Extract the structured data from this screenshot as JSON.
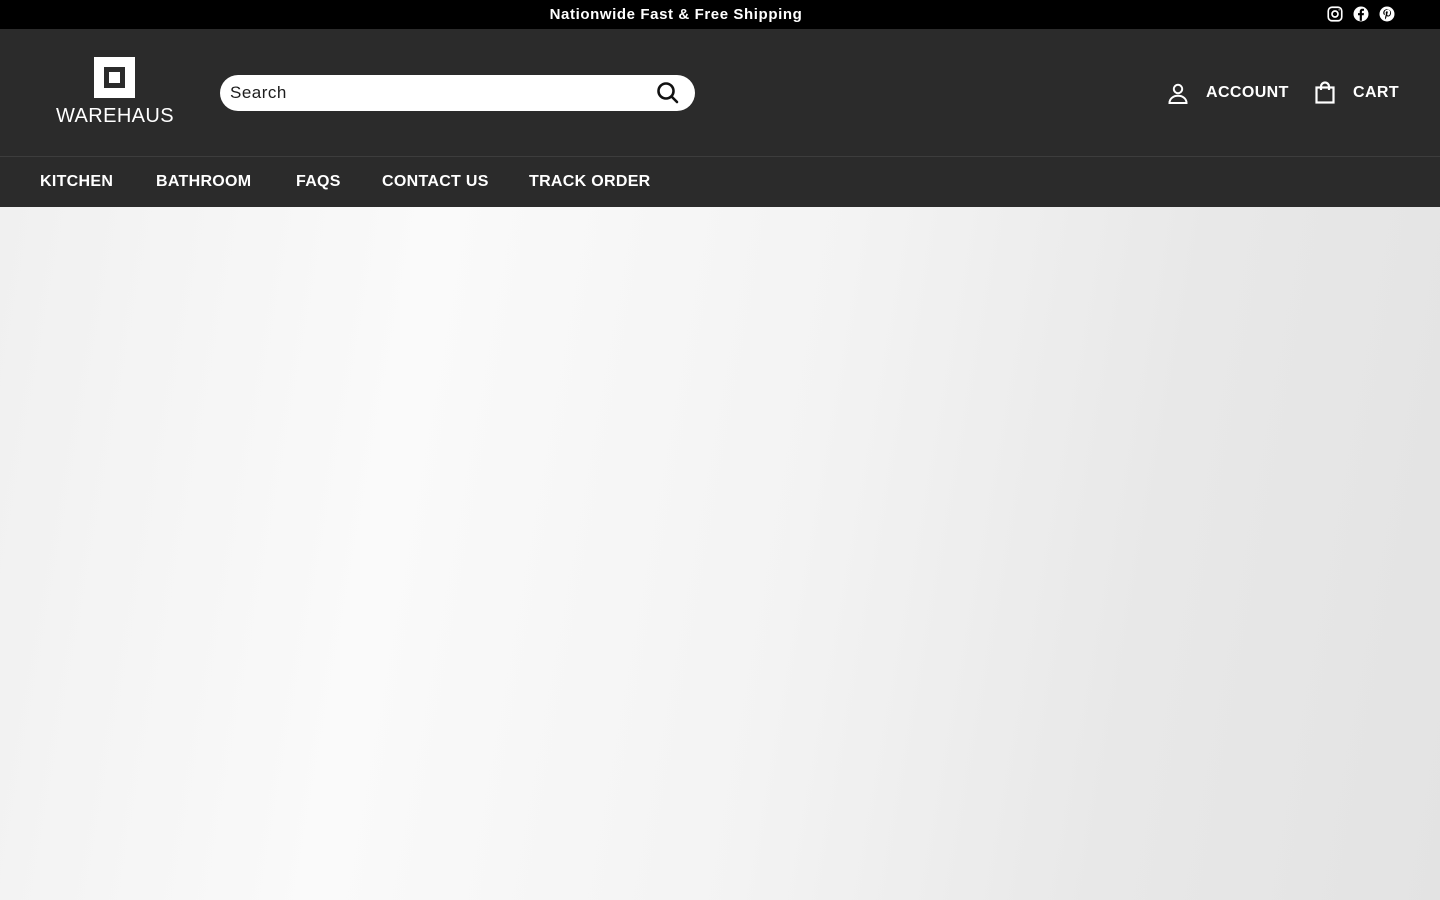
{
  "announcement": {
    "text": "Nationwide Fast & Free Shipping",
    "social": [
      "instagram-icon",
      "facebook-icon",
      "pinterest-icon"
    ]
  },
  "header": {
    "logo_text": "WAREHAUS",
    "search": {
      "placeholder": "Search",
      "value": ""
    },
    "account_label": "ACCOUNT",
    "cart_label": "CART"
  },
  "nav": {
    "items": [
      {
        "label": "KITCHEN"
      },
      {
        "label": "BATHROOM"
      },
      {
        "label": "FAQS"
      },
      {
        "label": "CONTACT US"
      },
      {
        "label": "TRACK ORDER"
      }
    ]
  },
  "colors": {
    "announcement_bg": "#000000",
    "header_bg": "#2b2b2b",
    "text_light": "#ffffff"
  }
}
